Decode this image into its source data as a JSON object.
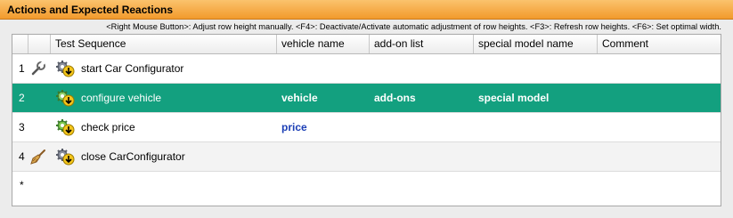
{
  "panel": {
    "title": "Actions and Expected Reactions",
    "hint": "<Right Mouse Button>: Adjust row height manually. <F4>: Deactivate/Activate automatic adjustment of row heights. <F3>: Refresh row heights. <F6>: Set optimal width."
  },
  "table": {
    "columns": [
      "Test Sequence",
      "vehicle name",
      "add-on list",
      "special model name",
      "Comment"
    ],
    "rows": [
      {
        "num": "1",
        "tool_icon": "wrench-icon",
        "step_icon": "gear-arrow-icon",
        "name": "start Car Configurator",
        "vehicle": "",
        "addon": "",
        "special": "",
        "comment": ""
      },
      {
        "num": "2",
        "tool_icon": "",
        "step_icon": "gear-arrow-icon",
        "name": "configure vehicle",
        "vehicle": "vehicle",
        "addon": "add-ons",
        "special": "special model",
        "comment": ""
      },
      {
        "num": "3",
        "tool_icon": "",
        "step_icon": "gear-arrow-icon",
        "name": "check price",
        "vehicle": "price",
        "addon": "",
        "special": "",
        "comment": ""
      },
      {
        "num": "4",
        "tool_icon": "broom-icon",
        "step_icon": "gear-arrow-icon",
        "name": "close CarConfigurator",
        "vehicle": "",
        "addon": "",
        "special": "",
        "comment": ""
      }
    ],
    "new_row_marker": "*",
    "selected_row": "2"
  },
  "colors": {
    "title_bar": "#f29a2c",
    "selected_row": "#13a07f",
    "parameter_blue": "#1c3fb6"
  }
}
